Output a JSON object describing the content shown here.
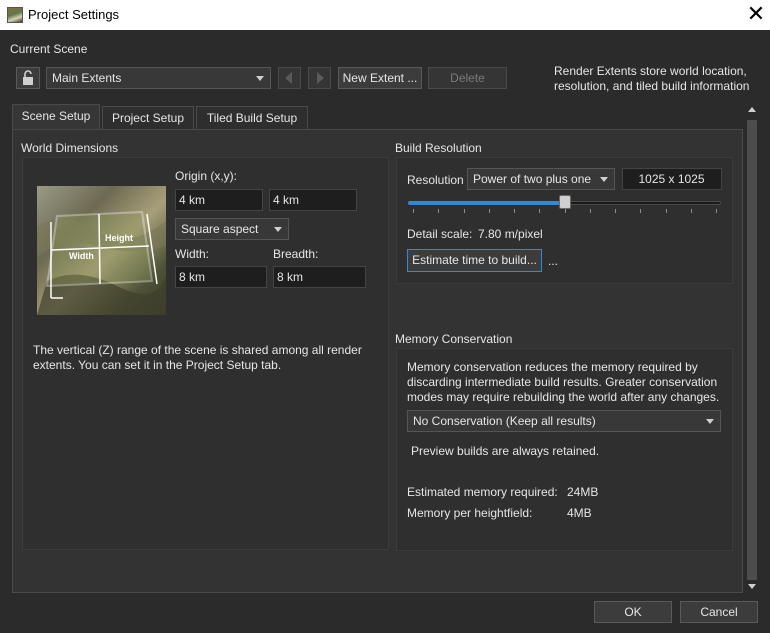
{
  "window": {
    "title": "Project Settings"
  },
  "current_scene": {
    "heading": "Current Scene",
    "extent_selected": "Main Extents",
    "new_extent_label": "New Extent ...",
    "delete_label": "Delete",
    "info_line1": "Render Extents store world location,",
    "info_line2": "resolution, and tiled build information"
  },
  "tabs": [
    {
      "label": "Scene Setup",
      "active": true
    },
    {
      "label": "Project Setup",
      "active": false
    },
    {
      "label": "Tiled Build Setup",
      "active": false
    }
  ],
  "world_dimensions": {
    "heading": "World Dimensions",
    "origin_label": "Origin (x,y):",
    "origin_x": "4 km",
    "origin_y": "4 km",
    "aspect_selected": "Square aspect",
    "width_label": "Width:",
    "breadth_label": "Breadth:",
    "width_value": "8 km",
    "breadth_value": "8 km",
    "thumb_label_width": "Width",
    "thumb_label_height": "Height",
    "note_line1": "The vertical (Z) range of the scene is shared among all render",
    "note_line2": "extents. You can set it in the Project Setup tab."
  },
  "build_resolution": {
    "heading": "Build Resolution",
    "resolution_label": "Resolution",
    "resolution_mode": "Power of two plus one",
    "resolution_value": "1025 x 1025",
    "slider_fraction": 0.5,
    "detail_scale_label": "Detail scale:",
    "detail_scale_value": "7.80 m/pixel",
    "estimate_button": "Estimate time to build...",
    "estimate_result": "..."
  },
  "memory_conservation": {
    "heading": "Memory Conservation",
    "desc_line1": "Memory conservation reduces the memory required by",
    "desc_line2": "discarding intermediate build results. Greater conservation",
    "desc_line3": "modes may require rebuilding the world after any changes.",
    "mode_selected": "No Conservation (Keep all results)",
    "preview_note": "Preview builds are always retained.",
    "est_mem_label": "Estimated memory required:",
    "est_mem_value": "24MB",
    "per_hf_label": "Memory per heightfield:",
    "per_hf_value": "4MB"
  },
  "footer": {
    "ok_label": "OK",
    "cancel_label": "Cancel"
  },
  "colors": {
    "accent": "#2e8ad8",
    "background": "#2b2b2b"
  }
}
